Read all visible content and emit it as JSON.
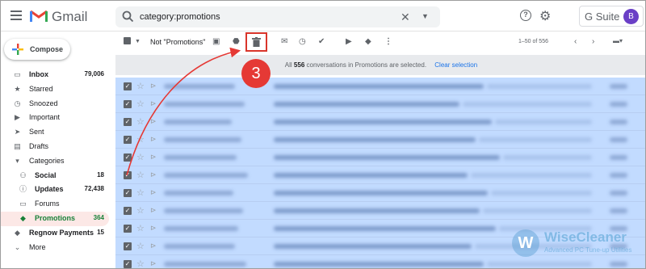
{
  "header": {
    "logo_text": "Gmail",
    "search_query": "category:promotions",
    "gsuite_label": "G Suite",
    "avatar_letter": "B"
  },
  "compose_label": "Compose",
  "sidebar": [
    {
      "label": "Inbox",
      "count": "79,006",
      "icon": "inbox-icon",
      "glyph": "▭",
      "bold": true,
      "sub": false,
      "active": false
    },
    {
      "label": "Starred",
      "count": "",
      "icon": "star-icon",
      "glyph": "★",
      "bold": false,
      "sub": false,
      "active": false
    },
    {
      "label": "Snoozed",
      "count": "",
      "icon": "clock-icon",
      "glyph": "◷",
      "bold": false,
      "sub": false,
      "active": false
    },
    {
      "label": "Important",
      "count": "",
      "icon": "important-icon",
      "glyph": "▶",
      "bold": false,
      "sub": false,
      "active": false
    },
    {
      "label": "Sent",
      "count": "",
      "icon": "send-icon",
      "glyph": "➤",
      "bold": false,
      "sub": false,
      "active": false
    },
    {
      "label": "Drafts",
      "count": "",
      "icon": "draft-icon",
      "glyph": "▤",
      "bold": false,
      "sub": false,
      "active": false
    },
    {
      "label": "Categories",
      "count": "",
      "icon": "categories-icon",
      "glyph": "▾",
      "bold": false,
      "sub": false,
      "active": false
    },
    {
      "label": "Social",
      "count": "18",
      "icon": "people-icon",
      "glyph": "⚇",
      "bold": true,
      "sub": true,
      "active": false
    },
    {
      "label": "Updates",
      "count": "72,438",
      "icon": "info-icon",
      "glyph": "ⓘ",
      "bold": true,
      "sub": true,
      "active": false
    },
    {
      "label": "Forums",
      "count": "",
      "icon": "forum-icon",
      "glyph": "▭",
      "bold": false,
      "sub": true,
      "active": false
    },
    {
      "label": "Promotions",
      "count": "364",
      "icon": "tag-icon",
      "glyph": "◆",
      "bold": true,
      "sub": true,
      "active": true
    },
    {
      "label": "Regnow Payments",
      "count": "15",
      "icon": "label-icon",
      "glyph": "◆",
      "bold": true,
      "sub": false,
      "active": false
    },
    {
      "label": "More",
      "count": "",
      "icon": "chevron-down-icon",
      "glyph": "⌄",
      "bold": false,
      "sub": false,
      "active": false
    }
  ],
  "toolbar": {
    "filter_label": "Not \"Promotions\"",
    "pager": "1–50 of 556"
  },
  "banner": {
    "prefix": "All",
    "count": "556",
    "suffix": "conversations in Promotions are selected.",
    "clear_label": "Clear selection"
  },
  "annotation": {
    "step": "3"
  },
  "watermark": {
    "title": "WiseCleaner",
    "subtitle": "Advanced PC Tune-up Utilities"
  },
  "colors": {
    "accent_red": "#e53935",
    "selected_row": "#c2dbff",
    "active_category": "#188038"
  }
}
